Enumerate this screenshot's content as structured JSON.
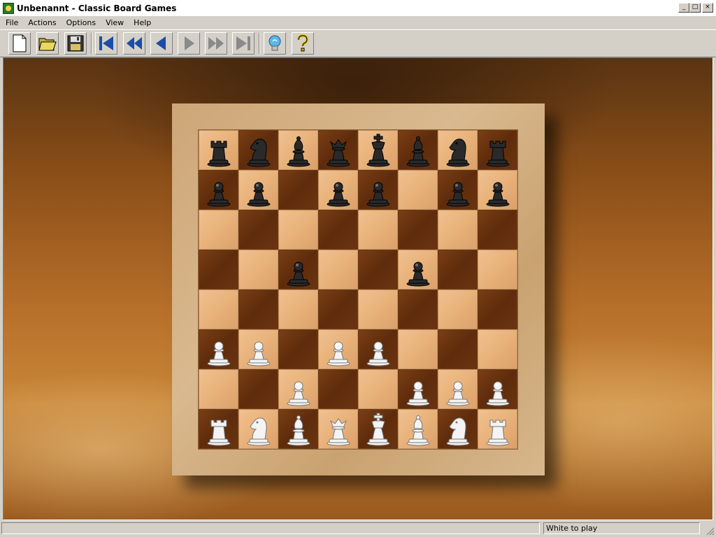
{
  "window": {
    "title": "Unbenannt - Classic Board Games",
    "buttons": {
      "minimize": "_",
      "maximize": "□",
      "close": "×"
    }
  },
  "menu": [
    {
      "label": "File"
    },
    {
      "label": "Actions"
    },
    {
      "label": "Options"
    },
    {
      "label": "View"
    },
    {
      "label": "Help"
    }
  ],
  "toolbar": [
    {
      "name": "new-game-button",
      "icon": "new-document-icon"
    },
    {
      "name": "open-game-button",
      "icon": "open-folder-icon"
    },
    {
      "name": "save-game-button",
      "icon": "floppy-disk-icon"
    },
    {
      "name": "first-move-button",
      "icon": "skip-to-start-icon"
    },
    {
      "name": "back-5-moves-button",
      "icon": "fast-rewind-icon"
    },
    {
      "name": "previous-move-button",
      "icon": "step-back-icon"
    },
    {
      "name": "next-move-button",
      "icon": "step-forward-icon"
    },
    {
      "name": "forward-5-moves-button",
      "icon": "fast-forward-icon"
    },
    {
      "name": "last-move-button",
      "icon": "skip-to-end-icon"
    },
    {
      "name": "hint-button",
      "icon": "lightbulb-icon"
    },
    {
      "name": "help-button",
      "icon": "question-mark-icon"
    }
  ],
  "board": {
    "rows": [
      [
        "bR",
        "bN",
        "bB",
        "bQ",
        "bK",
        "bB",
        "bN",
        "bR"
      ],
      [
        "bP",
        "bP",
        "",
        "bP",
        "bP",
        "",
        "bP",
        "bP"
      ],
      [
        "",
        "",
        "",
        "",
        "",
        "",
        "",
        ""
      ],
      [
        "",
        "",
        "bP",
        "",
        "",
        "bP",
        "",
        ""
      ],
      [
        "",
        "",
        "",
        "",
        "",
        "",
        "",
        ""
      ],
      [
        "wP",
        "wP",
        "",
        "wP",
        "wP",
        "",
        "",
        ""
      ],
      [
        "",
        "",
        "wP",
        "",
        "",
        "wP",
        "wP",
        "wP"
      ],
      [
        "wR",
        "wN",
        "wB",
        "wQ",
        "wK",
        "wB",
        "wN",
        "wR"
      ]
    ],
    "colors": {
      "light": "#e8b27a",
      "dark": "#6a3410",
      "white_piece": "#f4f4f4",
      "black_piece": "#2a2a2a"
    }
  },
  "status": {
    "text": "White to play"
  }
}
